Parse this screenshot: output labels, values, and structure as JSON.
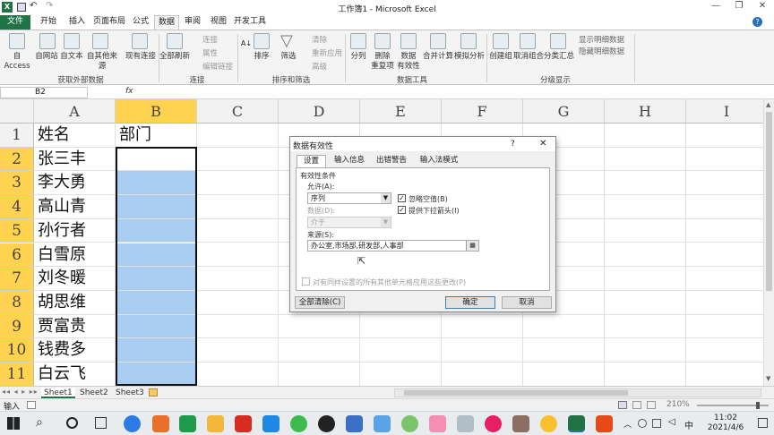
{
  "window": {
    "title": "工作簿1 - Microsoft Excel"
  },
  "ribbon_tabs": [
    "文件",
    "开始",
    "插入",
    "页面布局",
    "公式",
    "数据",
    "审阅",
    "视图",
    "开发工具"
  ],
  "ribbon": {
    "get_external": [
      "自 Access",
      "自网站",
      "自文本",
      "自其他来源",
      "现有连接"
    ],
    "get_external_label": "获取外部数据",
    "refresh_all": "全部刷新",
    "connections_small": [
      "连接",
      "属性",
      "编辑链接"
    ],
    "connections_label": "连接",
    "sort": "排序",
    "filter": "筛选",
    "sort_small": [
      "清除",
      "重新应用",
      "高级"
    ],
    "sort_label": "排序和筛选",
    "tools": [
      "分列",
      "删除\n重复项",
      "数据\n有效性",
      "合并计算",
      "模拟分析"
    ],
    "tools_label": "数据工具",
    "outline": [
      "创建组",
      "取消组合",
      "分类汇总"
    ],
    "outline_small": [
      "显示明细数据",
      "隐藏明细数据"
    ],
    "outline_label": "分级显示"
  },
  "formula_bar": {
    "name_box": "B2",
    "fx": "fx",
    "value": ""
  },
  "columns": [
    "A",
    "B",
    "C",
    "D",
    "E",
    "F",
    "G",
    "H",
    "I"
  ],
  "rows": [
    {
      "num": "1",
      "a": "姓名",
      "b": "部门"
    },
    {
      "num": "2",
      "a": "张三丰",
      "b": ""
    },
    {
      "num": "3",
      "a": "李大勇",
      "b": ""
    },
    {
      "num": "4",
      "a": "高山青",
      "b": ""
    },
    {
      "num": "5",
      "a": "孙行者",
      "b": ""
    },
    {
      "num": "6",
      "a": "白雪原",
      "b": ""
    },
    {
      "num": "7",
      "a": "刘冬暖",
      "b": ""
    },
    {
      "num": "8",
      "a": "胡思维",
      "b": ""
    },
    {
      "num": "9",
      "a": "贾富贵",
      "b": ""
    },
    {
      "num": "10",
      "a": "钱费多",
      "b": ""
    },
    {
      "num": "11",
      "a": "白云飞",
      "b": ""
    }
  ],
  "sheets": [
    "Sheet1",
    "Sheet2",
    "Sheet3"
  ],
  "status": {
    "mode": "输入",
    "zoom": "210%"
  },
  "dialog": {
    "title": "数据有效性",
    "help": "?",
    "close": "✕",
    "tabs": [
      "设置",
      "输入信息",
      "出错警告",
      "输入法模式"
    ],
    "section": "有效性条件",
    "allow_label": "允许(A):",
    "allow_value": "序列",
    "data_label": "数据(D):",
    "data_value": "介于",
    "ignore_blank": "忽略空值(B)",
    "dropdown": "提供下拉箭头(I)",
    "source_label": "来源(S):",
    "source_value": "办公室,市场部,研发部,人事部",
    "apply_all": "对有同样设置的所有其他单元格应用这些更改(P)",
    "clear_all": "全部清除(C)",
    "ok": "确定",
    "cancel": "取消"
  },
  "taskbar": {
    "time": "11:02",
    "date": "2021/4/6",
    "ime": "中"
  }
}
